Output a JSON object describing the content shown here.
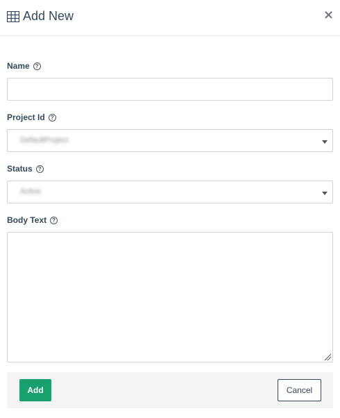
{
  "header": {
    "title": "Add New",
    "icon": "table-icon",
    "close_icon": "close-icon",
    "close_glyph": "×"
  },
  "fields": {
    "name": {
      "label": "Name",
      "value": "",
      "placeholder": ""
    },
    "project_id": {
      "label": "Project Id",
      "value": "DefaultProject"
    },
    "status": {
      "label": "Status",
      "value": "Active"
    },
    "body_text": {
      "label": "Body Text",
      "value": ""
    }
  },
  "help_glyph": "?",
  "footer": {
    "add_label": "Add",
    "cancel_label": "Cancel"
  },
  "colors": {
    "primary": "#18a06e",
    "text": "#34495e",
    "border": "#ced4da",
    "footer_bg": "#f4f4f4"
  }
}
